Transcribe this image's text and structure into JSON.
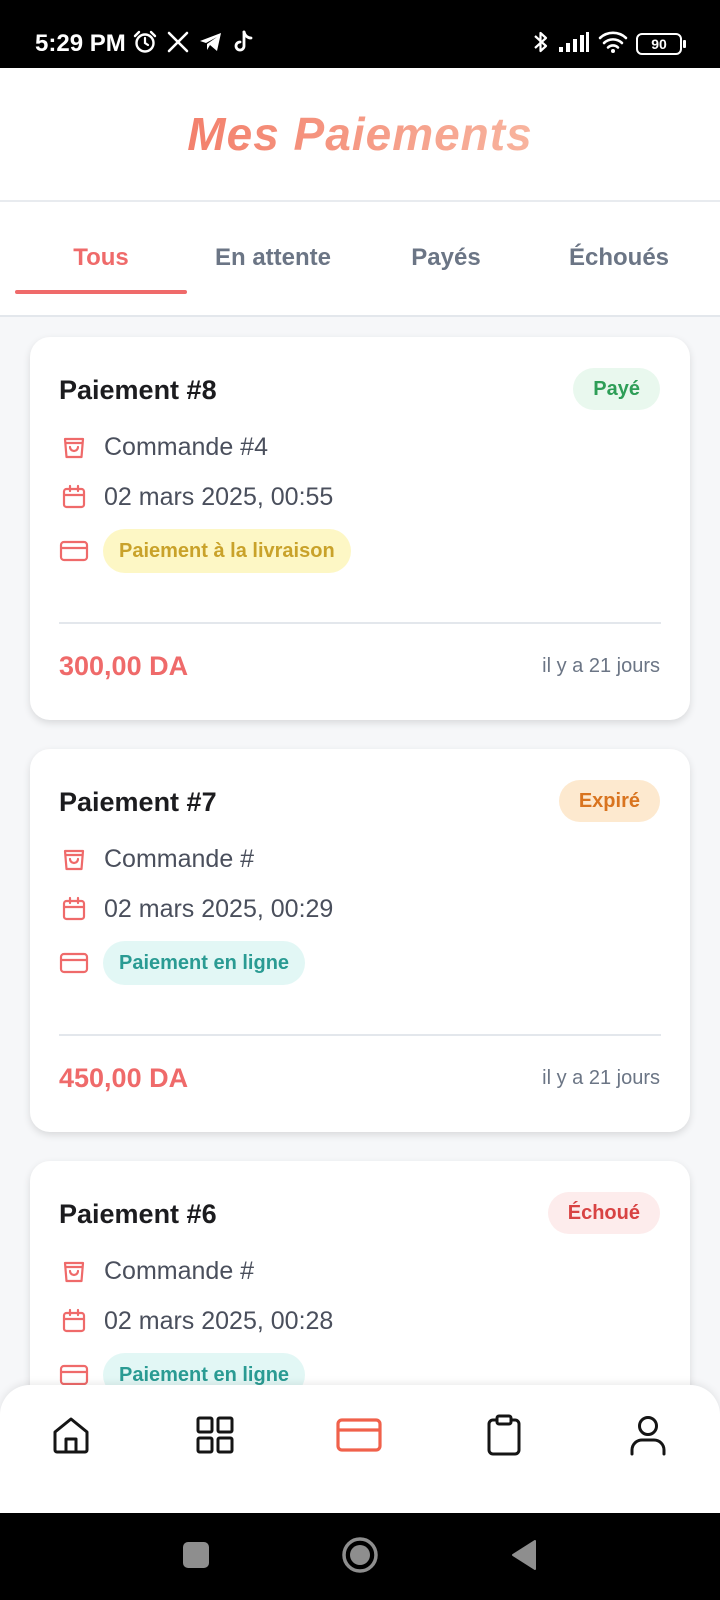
{
  "status_bar": {
    "time": "5:29 PM",
    "battery": "90",
    "icons": [
      "alarm-icon",
      "x-icon",
      "telegram-icon",
      "tiktok-icon",
      "bluetooth-icon",
      "signal-icon",
      "wifi-icon",
      "battery-icon"
    ]
  },
  "header": {
    "title": "Mes Paiements"
  },
  "tabs": [
    {
      "label": "Tous",
      "active": true
    },
    {
      "label": "En attente",
      "active": false
    },
    {
      "label": "Payés",
      "active": false
    },
    {
      "label": "Échoués",
      "active": false
    }
  ],
  "payments": [
    {
      "title": "Paiement #8",
      "status": "Payé",
      "order": "Commande #4",
      "date": "02 mars 2025, 00:55",
      "method": "Paiement à la livraison",
      "amount": "300,00 DA",
      "time_ago": "il y a 21 jours"
    },
    {
      "title": "Paiement #7",
      "status": "Expiré",
      "order": "Commande #",
      "date": "02 mars 2025, 00:29",
      "method": "Paiement en ligne",
      "amount": "450,00 DA",
      "time_ago": "il y a 21 jours"
    },
    {
      "title": "Paiement #6",
      "status": "Échoué",
      "order": "Commande #",
      "date": "02 mars 2025, 00:28",
      "method": "Paiement en ligne",
      "amount": "",
      "time_ago": ""
    }
  ],
  "bottom_nav": [
    "home-icon",
    "grid-icon",
    "card-icon",
    "clipboard-icon",
    "user-icon"
  ],
  "colors": {
    "accent": "#ef6a6a",
    "nav_active": "#f0614b",
    "paid_bg": "#e9f8ee",
    "paid_text": "#2e9e57",
    "expired_bg": "#fde9cf",
    "expired_text": "#d9741f",
    "failed_bg": "#fdecec",
    "failed_text": "#d84343",
    "cod_bg": "#fdf7c5",
    "cod_text": "#c9a22a",
    "online_bg": "#e2f7f5",
    "online_text": "#2a9b93"
  }
}
